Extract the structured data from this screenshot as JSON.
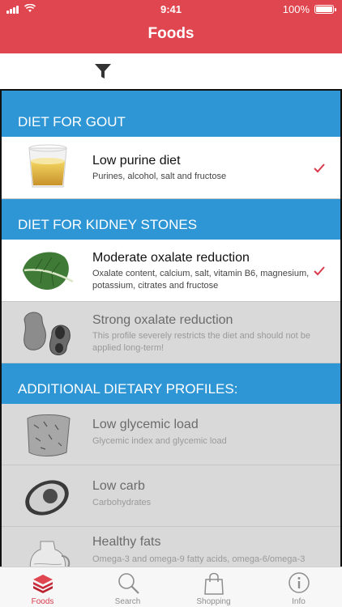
{
  "status": {
    "time": "9:41",
    "battery": "100%"
  },
  "nav": {
    "title": "Foods"
  },
  "filter": {
    "icon": "funnel-icon"
  },
  "sections": [
    {
      "header": "DIET FOR GOUT",
      "rows": [
        {
          "title": "Low purine diet",
          "subtitle": "Purines, alcohol, salt and fructose",
          "checked": true,
          "enabled": true,
          "image": "beer-glass"
        }
      ]
    },
    {
      "header": "DIET FOR KIDNEY STONES",
      "rows": [
        {
          "title": "Moderate oxalate reduction",
          "subtitle": "Oxalate content, calcium, salt, vitamin B6, magnesium, potassium, citrates and fructose",
          "checked": true,
          "enabled": true,
          "image": "leafy-green"
        },
        {
          "title": "Strong oxalate reduction",
          "subtitle": "This profile severely restricts the diet and should not be applied long-term!",
          "checked": false,
          "enabled": false,
          "image": "peanuts"
        }
      ]
    },
    {
      "header": "ADDITIONAL DIETARY PROFILES:",
      "rows": [
        {
          "title": "Low glycemic load",
          "subtitle": "Glycemic index and glycemic load",
          "checked": false,
          "enabled": false,
          "image": "bread"
        },
        {
          "title": "Low carb",
          "subtitle": "Carbohydrates",
          "checked": false,
          "enabled": false,
          "image": "avocado"
        },
        {
          "title": "Healthy fats",
          "subtitle": "Omega-3 and omega-9 fatty acids, omega-6/omega-3",
          "checked": false,
          "enabled": false,
          "image": "oil-jug"
        }
      ]
    }
  ],
  "tabs": [
    {
      "label": "Foods",
      "icon": "stack-icon",
      "active": true
    },
    {
      "label": "Search",
      "icon": "magnifier-icon",
      "active": false
    },
    {
      "label": "Shopping",
      "icon": "shopping-bag-icon",
      "active": false
    },
    {
      "label": "Info",
      "icon": "info-icon",
      "active": false
    }
  ],
  "colors": {
    "navbar": "#e0464f",
    "section": "#2f96d6",
    "check": "#d9394a",
    "activeTab": "#d9394a"
  }
}
